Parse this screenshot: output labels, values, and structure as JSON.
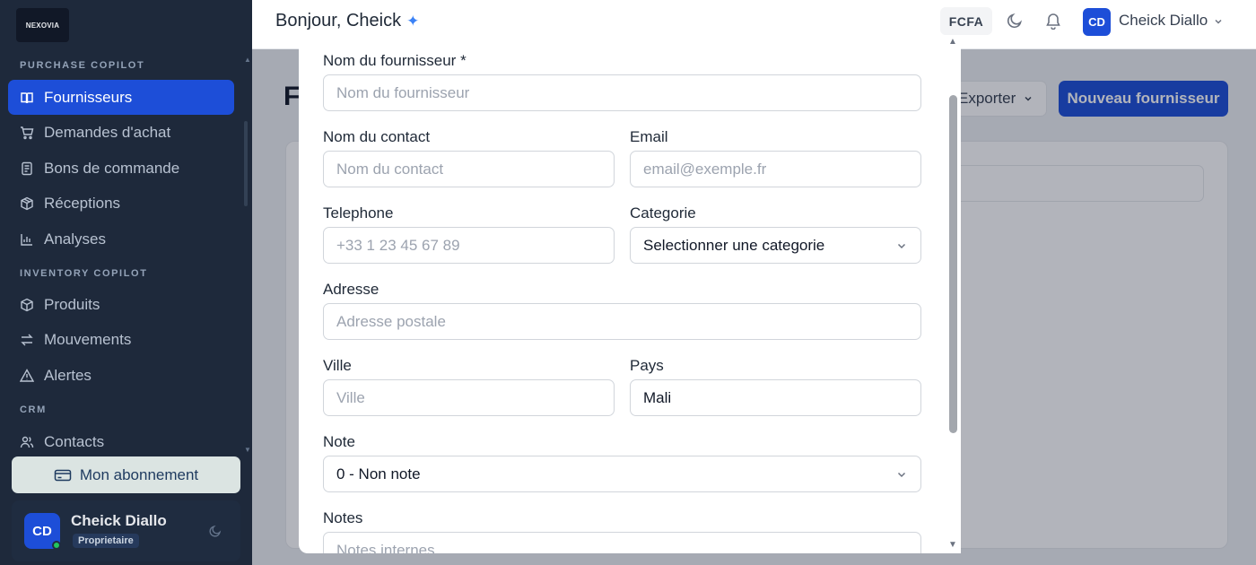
{
  "app": {
    "logo_text": "NEXOVIA"
  },
  "sidebar": {
    "sections": [
      {
        "title": "PURCHASE COPILOT"
      },
      {
        "title": "INVENTORY COPILOT"
      },
      {
        "title": "CRM"
      }
    ],
    "items": [
      {
        "label": "Fournisseurs",
        "icon": "book-icon",
        "active": true
      },
      {
        "label": "Demandes d'achat",
        "icon": "cart-icon"
      },
      {
        "label": "Bons de commande",
        "icon": "document-icon"
      },
      {
        "label": "Réceptions",
        "icon": "package-icon"
      },
      {
        "label": "Analyses",
        "icon": "chart-icon"
      },
      {
        "label": "Produits",
        "icon": "box-icon"
      },
      {
        "label": "Mouvements",
        "icon": "arrows-icon"
      },
      {
        "label": "Alertes",
        "icon": "warning-icon"
      },
      {
        "label": "Contacts",
        "icon": "users-icon"
      }
    ],
    "subscription_label": "Mon abonnement",
    "user": {
      "initials": "CD",
      "name": "Cheick Diallo",
      "role": "Proprietaire"
    }
  },
  "topbar": {
    "greeting": "Bonjour, Cheick",
    "currency": "FCFA",
    "user_initials": "CD",
    "user_name": "Cheick Diallo"
  },
  "main": {
    "title_visible": "F",
    "export_label": "Exporter",
    "new_label": "Nouveau fournisseur"
  },
  "form": {
    "supplier_name": {
      "label": "Nom du fournisseur *",
      "placeholder": "Nom du fournisseur"
    },
    "contact_name": {
      "label": "Nom du contact",
      "placeholder": "Nom du contact"
    },
    "email": {
      "label": "Email",
      "placeholder": "email@exemple.fr"
    },
    "phone": {
      "label": "Telephone",
      "placeholder": "+33 1 23 45 67 89"
    },
    "category": {
      "label": "Categorie",
      "value": "Selectionner une categorie"
    },
    "address": {
      "label": "Adresse",
      "placeholder": "Adresse postale"
    },
    "city": {
      "label": "Ville",
      "placeholder": "Ville"
    },
    "country": {
      "label": "Pays",
      "value": "Mali"
    },
    "rating": {
      "label": "Note",
      "value": "0 - Non note"
    },
    "notes": {
      "label": "Notes",
      "placeholder": "Notes internes..."
    }
  },
  "colors": {
    "primary": "#1d4ed8",
    "sidebar_bg": "#1e293b",
    "online": "#22c55e"
  }
}
